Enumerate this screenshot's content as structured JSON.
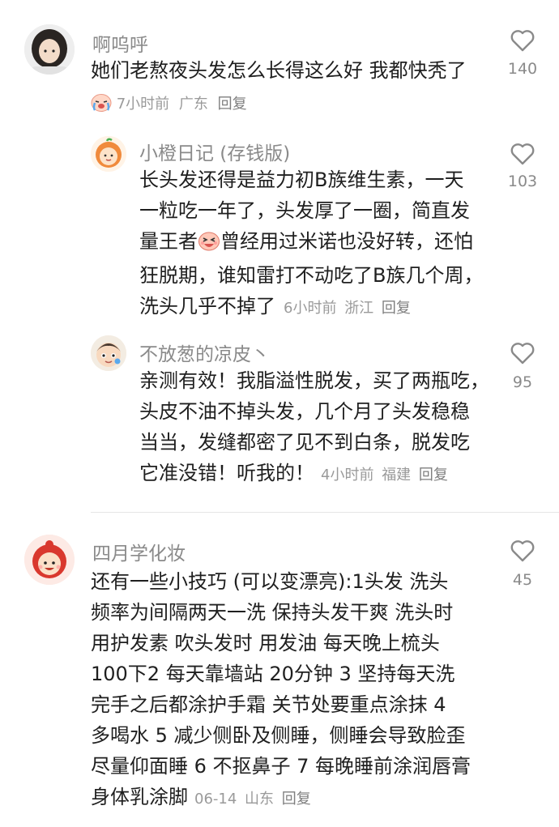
{
  "comments": [
    {
      "username": "啊呜呼",
      "lines": [
        "她们老熬夜头发怎么长得这么好 我都快秃了"
      ],
      "time": "7小时前",
      "location": "广东",
      "reply_label": "回复",
      "likes": "140",
      "avatar_icon": "girl-avatar",
      "leading_emoji": "crying-face-emoji"
    },
    {
      "username": "小橙日记 (存钱版)",
      "lines": [
        "长头发还得是益力初B族维生素，一天",
        "一粒吃一年了，头发厚了一圈，简直发",
        "曾经用过米诺也没好转，还怕",
        "狂脱期，谁知雷打不动吃了B族几个周，",
        "洗头几乎不掉了"
      ],
      "line3_prefix": "量王者",
      "time": "6小时前",
      "location": "浙江",
      "reply_label": "回复",
      "likes": "103",
      "avatar_icon": "orange-character-avatar",
      "inline_emoji": "excited-face-emoji"
    },
    {
      "username": "不放葱的凉皮丶",
      "lines": [
        "亲测有效！我脂溢性脱发，买了两瓶吃，",
        "头皮不油不掉头发，几个月了头发稳稳",
        "当当，发缝都密了见不到白条，脱发吃",
        "它准没错！听我的！"
      ],
      "time": "4小时前",
      "location": "福建",
      "reply_label": "回复",
      "likes": "95",
      "avatar_icon": "cartoon-boy-avatar"
    },
    {
      "username": "四月学化妆",
      "lines": [
        "还有一些小技巧 (可以变漂亮):1头发 洗头",
        "频率为间隔两天一洗 保持头发干爽 洗头时",
        "用护发素 吹头发时 用发油 每天晚上梳头",
        "100下2 每天靠墙站 20分钟 3 坚持每天洗",
        "完手之后都涂护手霜 关节处要重点涂抹 4",
        "多喝水 5 减少侧卧及侧睡，侧睡会导致脸歪",
        "尽量仰面睡 6 不抠鼻子 7 每晚睡前涂润唇膏",
        "身体乳涂脚"
      ],
      "time": "06-14",
      "location": "山东",
      "reply_label": "回复",
      "likes": "45",
      "avatar_icon": "red-hair-cartoon-avatar"
    }
  ],
  "colors": {
    "text": "#1f1f1f",
    "muted": "#8a8a8a",
    "divider": "#e6e6e6"
  }
}
